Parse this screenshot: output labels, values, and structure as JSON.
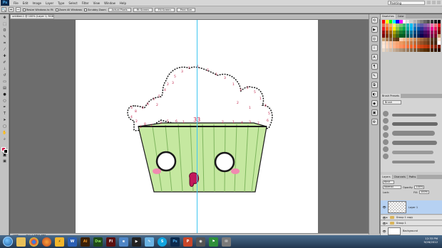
{
  "app": {
    "logo": "Ps"
  },
  "menu": [
    "File",
    "Edit",
    "Image",
    "Layer",
    "Type",
    "Select",
    "Filter",
    "View",
    "Window",
    "Help"
  ],
  "workspace": "Painting",
  "options": {
    "resize_windows": "Resize Windows to Fit",
    "zoom_all": "Zoom All Windows",
    "scrubby_zoom": "Scrubby Zoom",
    "actual_pixels": "Actual Pixels",
    "fit_screen": "Fit Screen",
    "fill_screen": "Fill Screen",
    "print_size": "Print Size"
  },
  "document": {
    "tab_title": "untitled-1 @ 100% (Layer 1, RGB/8#) *",
    "status_zoom": "100%",
    "status_doc": "Doc: 1.37M/1.48M"
  },
  "panels": {
    "color_tabs": [
      "Swatches",
      "Color"
    ],
    "brush_tab": "Brush Presets",
    "brush_button": "Brush",
    "layers_tabs": [
      "Layers",
      "Channels",
      "Paths"
    ],
    "blend_mode": "Normal",
    "opacity_label": "Opacity:",
    "opacity": "100%",
    "fill_label": "Fill:",
    "fill": "100%",
    "lock_label": "Lock:",
    "kind_label": "Kind"
  },
  "layers": [
    {
      "name": "Layer 1",
      "active": true,
      "type": "pixel"
    },
    {
      "name": "Group 1 copy",
      "active": false,
      "type": "group"
    },
    {
      "name": "Group 1",
      "active": false,
      "type": "group"
    },
    {
      "name": "Background",
      "active": false,
      "type": "background"
    }
  ],
  "canvas_text": {
    "top_number": "33",
    "frosting_numbers": [
      "8",
      "2",
      "6",
      "3",
      "5",
      "4",
      "2",
      "5",
      "3",
      "1",
      "1",
      "2",
      "1",
      "3",
      "1",
      "3",
      "2",
      "5",
      "1",
      "4",
      "5",
      "6",
      "7",
      "3",
      "4",
      "1",
      "2",
      "1",
      "6",
      "5",
      "3",
      "2",
      "8",
      "1",
      "2",
      "4",
      "5",
      "2",
      "3",
      "2",
      "1"
    ]
  },
  "taskbar": {
    "apps": [
      "folder-icon",
      "chrome-icon",
      "firefox-icon",
      "winamp-icon",
      "word-icon",
      "illustrator-icon",
      "dreamweaver-icon",
      "flash-icon",
      "explorer-icon",
      "media-icon",
      "paint-icon",
      "skype-icon",
      "photoshop-icon",
      "powerpoint-icon",
      "camera-icon",
      "game-icon",
      "mail-icon"
    ],
    "time": "12:33 PM",
    "date": "9/26/2012"
  },
  "colors": {
    "guide": "#3ec6f0",
    "cupcake_green": "#c5e8a0",
    "blush": "#f08ab0",
    "accent_highlight": "#b6d1f2"
  }
}
